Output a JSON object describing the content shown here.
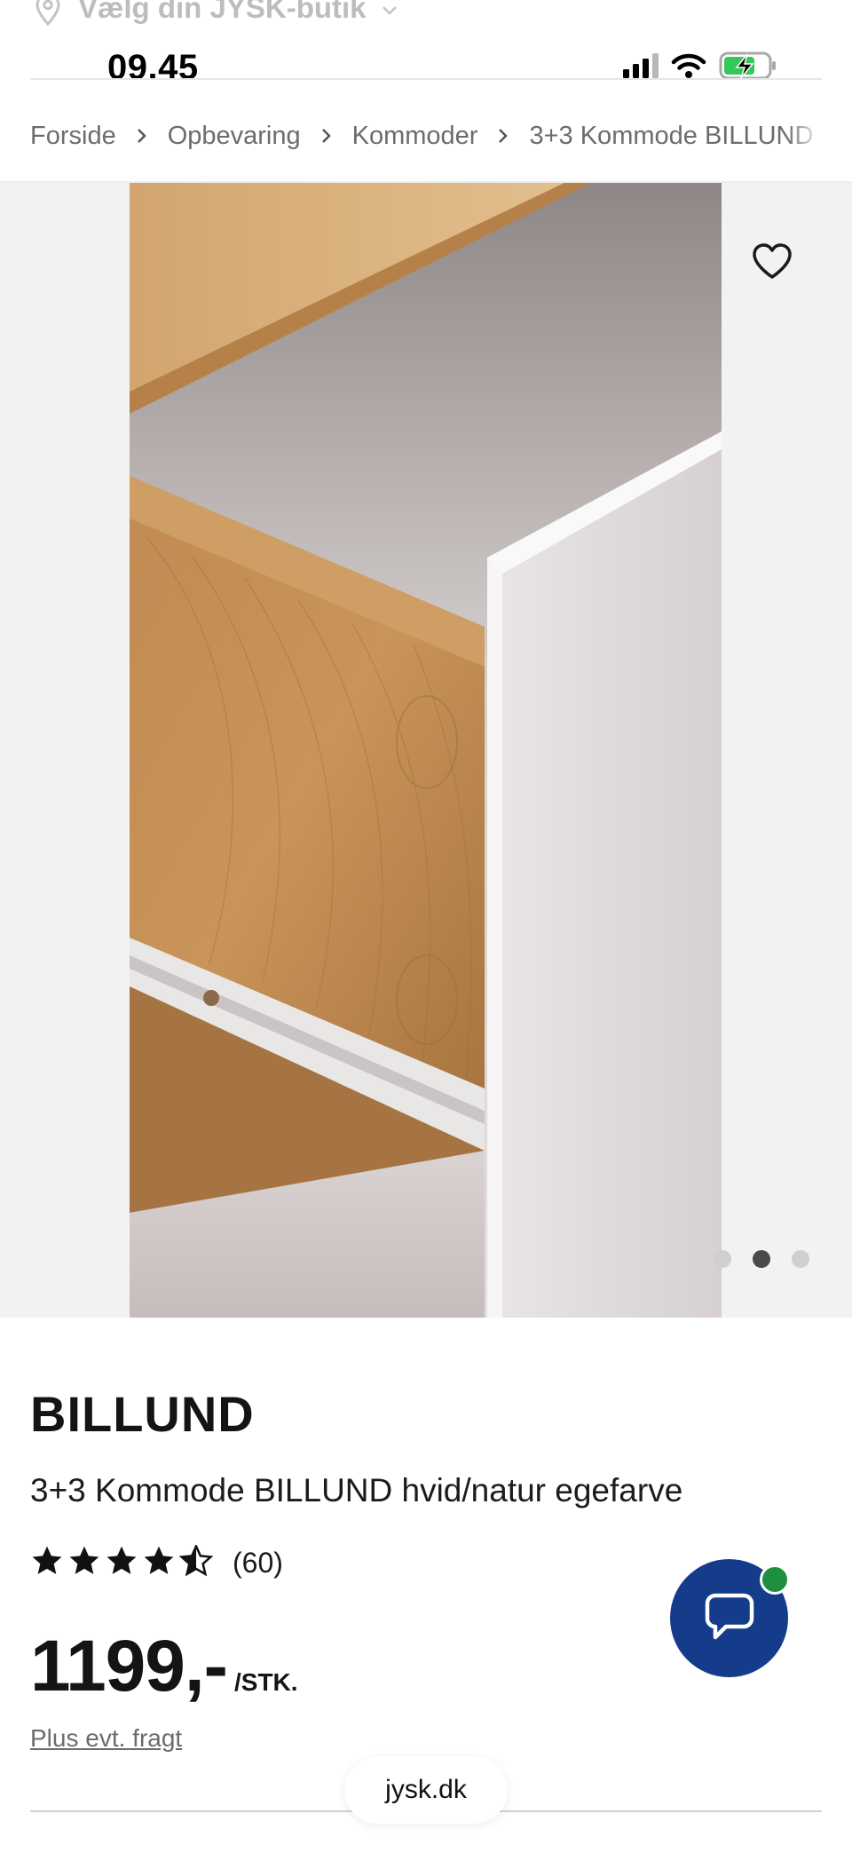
{
  "store_bar": {
    "label": "Vælg din JYSK-butik"
  },
  "status_bar": {
    "time": "09.45"
  },
  "breadcrumb": [
    "Forside",
    "Opbevaring",
    "Kommoder",
    "3+3 Kommode BILLUND"
  ],
  "gallery": {
    "image_count": 3,
    "active_index": 1
  },
  "product": {
    "brand": "BILLUND",
    "name": "3+3 Kommode BILLUND hvid/natur egefarve",
    "rating": 4.5,
    "rating_count": "(60)",
    "price": "1199,-",
    "unit": "/STK.",
    "shipping": "Plus evt. fragt"
  },
  "browser": {
    "url": "jysk.dk"
  },
  "colors": {
    "chat": "#143c8a",
    "badge": "#1e8f3e",
    "gallery_bg": "#f2f2f2"
  }
}
